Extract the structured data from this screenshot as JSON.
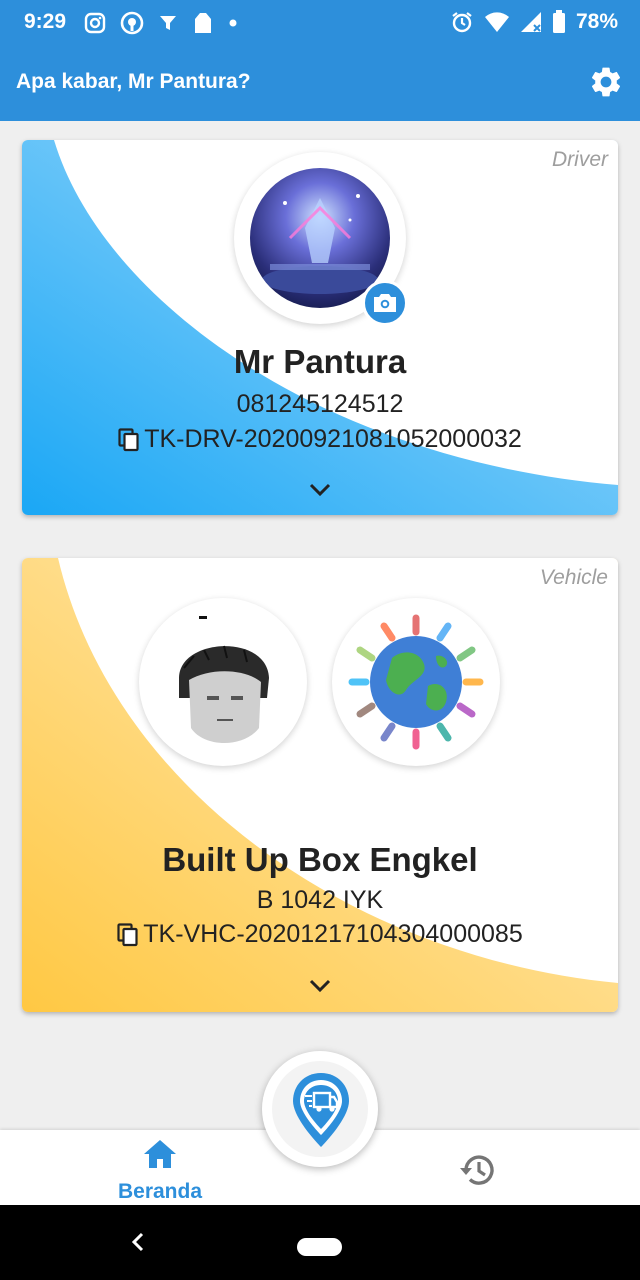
{
  "status_bar": {
    "time": "9:29",
    "battery": "78%",
    "left_icons": [
      "instagram-icon",
      "brand-icon",
      "filter-icon",
      "bag-icon",
      "dot-icon"
    ],
    "right_icons": [
      "alarm-icon",
      "wifi-icon",
      "signal-icon",
      "battery-icon"
    ]
  },
  "app_bar": {
    "greeting": "Apa kabar, Mr Pantura?",
    "settings_icon": "gear-icon"
  },
  "driver_card": {
    "tag": "Driver",
    "name": "Mr Pantura",
    "phone": "081245124512",
    "id": "TK-DRV-20200921081052000032",
    "gradient_colors": [
      "#1aa7f5",
      "#c9e8fd"
    ]
  },
  "vehicle_card": {
    "tag": "Vehicle",
    "name": "Built Up Box Engkel",
    "plate": "B 1042 IYK",
    "id": "TK-VHC-20201217104304000085",
    "gradient_colors": [
      "#ffc843",
      "#fde7b6"
    ]
  },
  "bottom_nav": {
    "home_label": "Beranda",
    "accent": "#2d8fdb",
    "inactive": "#757575"
  },
  "colors": {
    "primary": "#2d8fdb",
    "background": "#efefef"
  }
}
